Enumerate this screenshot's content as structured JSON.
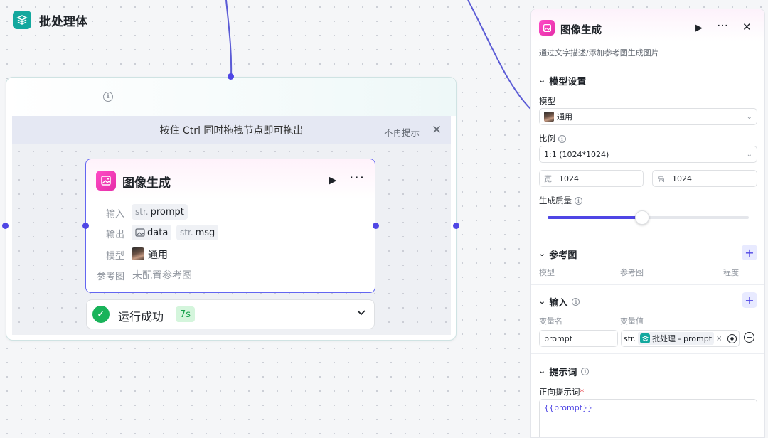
{
  "batch": {
    "title": "批处理体",
    "hint": "按住 Ctrl 同时拖拽节点即可拖出",
    "hint_dismiss": "不再提示"
  },
  "node": {
    "title": "图像生成",
    "rows": {
      "input_label": "输入",
      "input_type": "str.",
      "input_value": "prompt",
      "output_label": "输出",
      "output_data": "data",
      "output_type": "str.",
      "output_msg": "msg",
      "model_label": "模型",
      "model_value": "通用",
      "ref_label": "参考图",
      "ref_value": "未配置参考图"
    },
    "status": {
      "text": "运行成功",
      "time": "7s"
    }
  },
  "panel": {
    "title": "图像生成",
    "subtitle": "通过文字描述/添加参考图生成图片",
    "model_section": "模型设置",
    "model_label": "模型",
    "model_value": "通用",
    "ratio_label": "比例",
    "ratio_value": "1:1 (1024*1024)",
    "width_label": "宽",
    "width_value": "1024",
    "height_label": "高",
    "height_value": "1024",
    "quality_label": "生成质量",
    "quality_level": 0.47,
    "ref_section": "参考图",
    "ref_cols": [
      "模型",
      "参考图",
      "程度"
    ],
    "input_section": "输入",
    "var_name_col": "变量名",
    "var_value_col": "变量值",
    "var_name": "prompt",
    "var_type": "str.",
    "var_ref": "批处理 - prompt",
    "prompt_section": "提示词",
    "positive_label": "正向提示词",
    "required_mark": "*",
    "positive_value": "{{prompt}}"
  },
  "colors": {
    "accent": "#4f46e5",
    "batch_teal": "#13a89e",
    "node_pink": "#e52ea8",
    "success": "#19b35a"
  }
}
